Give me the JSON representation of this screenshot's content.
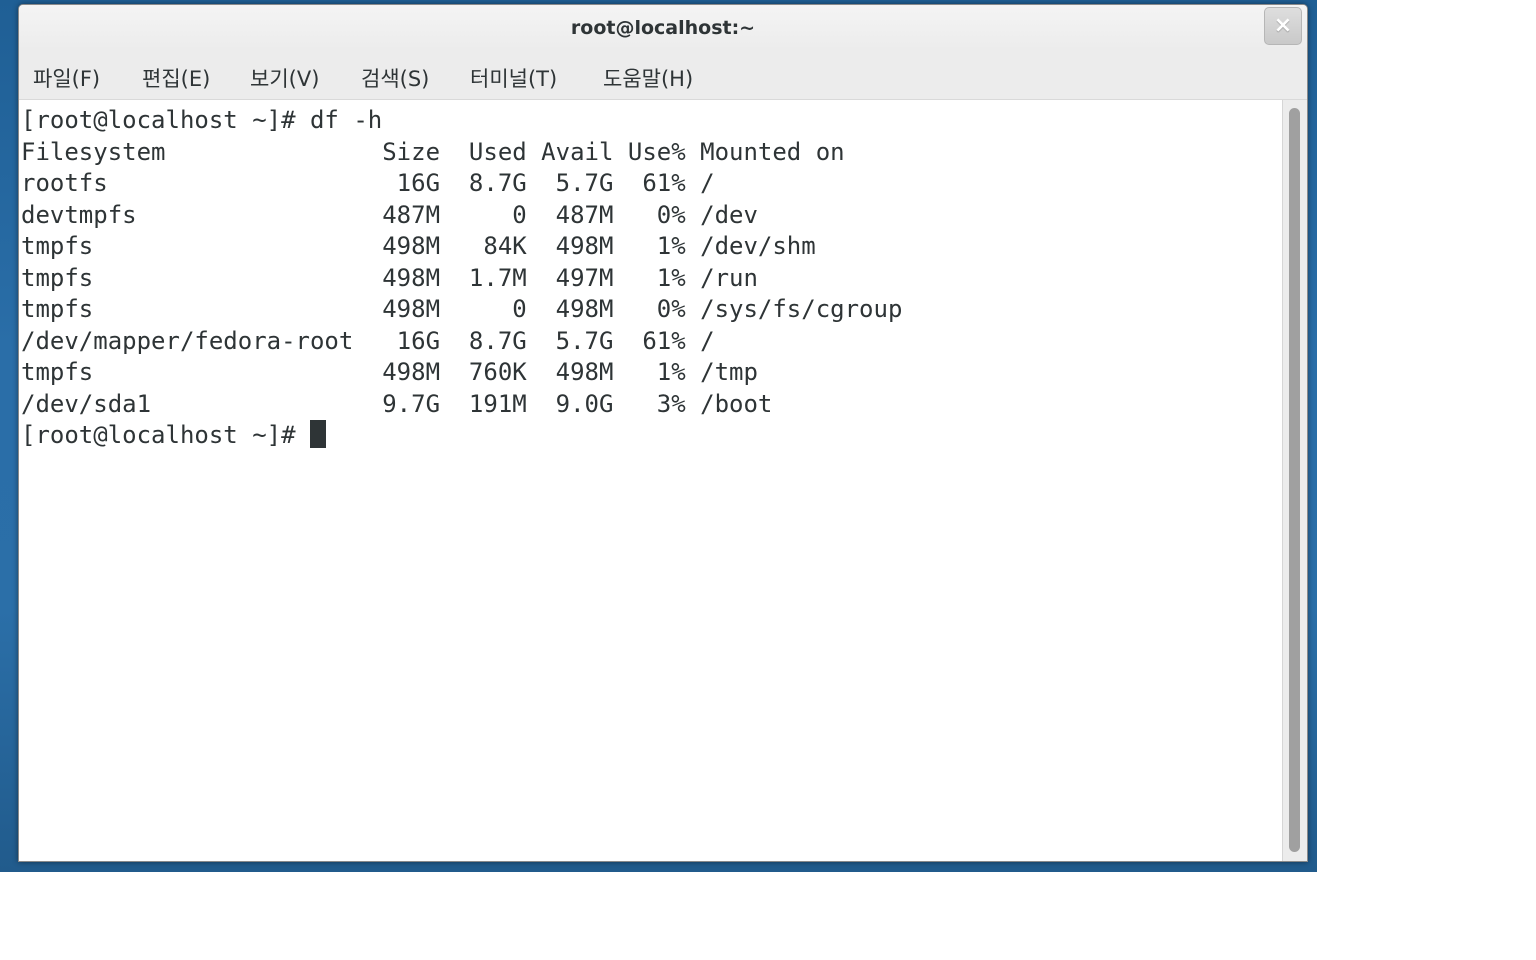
{
  "window": {
    "title": "root@localhost:~",
    "close_glyph": "×"
  },
  "menu": [
    {
      "label": "파일(F)"
    },
    {
      "label": "편집(E)"
    },
    {
      "label": "보기(V)"
    },
    {
      "label": "검색(S)"
    },
    {
      "label": "터미널(T)"
    },
    {
      "label": "도움말(H)"
    }
  ],
  "terminal": {
    "command_line": "[root@localhost ~]# df -h",
    "header": "Filesystem               Size  Used Avail Use% Mounted on",
    "rows": [
      "rootfs                    16G  8.7G  5.7G  61% /",
      "devtmpfs                 487M     0  487M   0% /dev",
      "tmpfs                    498M   84K  498M   1% /dev/shm",
      "tmpfs                    498M  1.7M  497M   1% /run",
      "tmpfs                    498M     0  498M   0% /sys/fs/cgroup",
      "/dev/mapper/fedora-root   16G  8.7G  5.7G  61% /",
      "tmpfs                    498M  760K  498M   1% /tmp",
      "/dev/sda1                9.7G  191M  9.0G   3% /boot"
    ],
    "prompt": "[root@localhost ~]# "
  },
  "icons": {
    "close": "close-icon",
    "cursor": "cursor-block"
  }
}
